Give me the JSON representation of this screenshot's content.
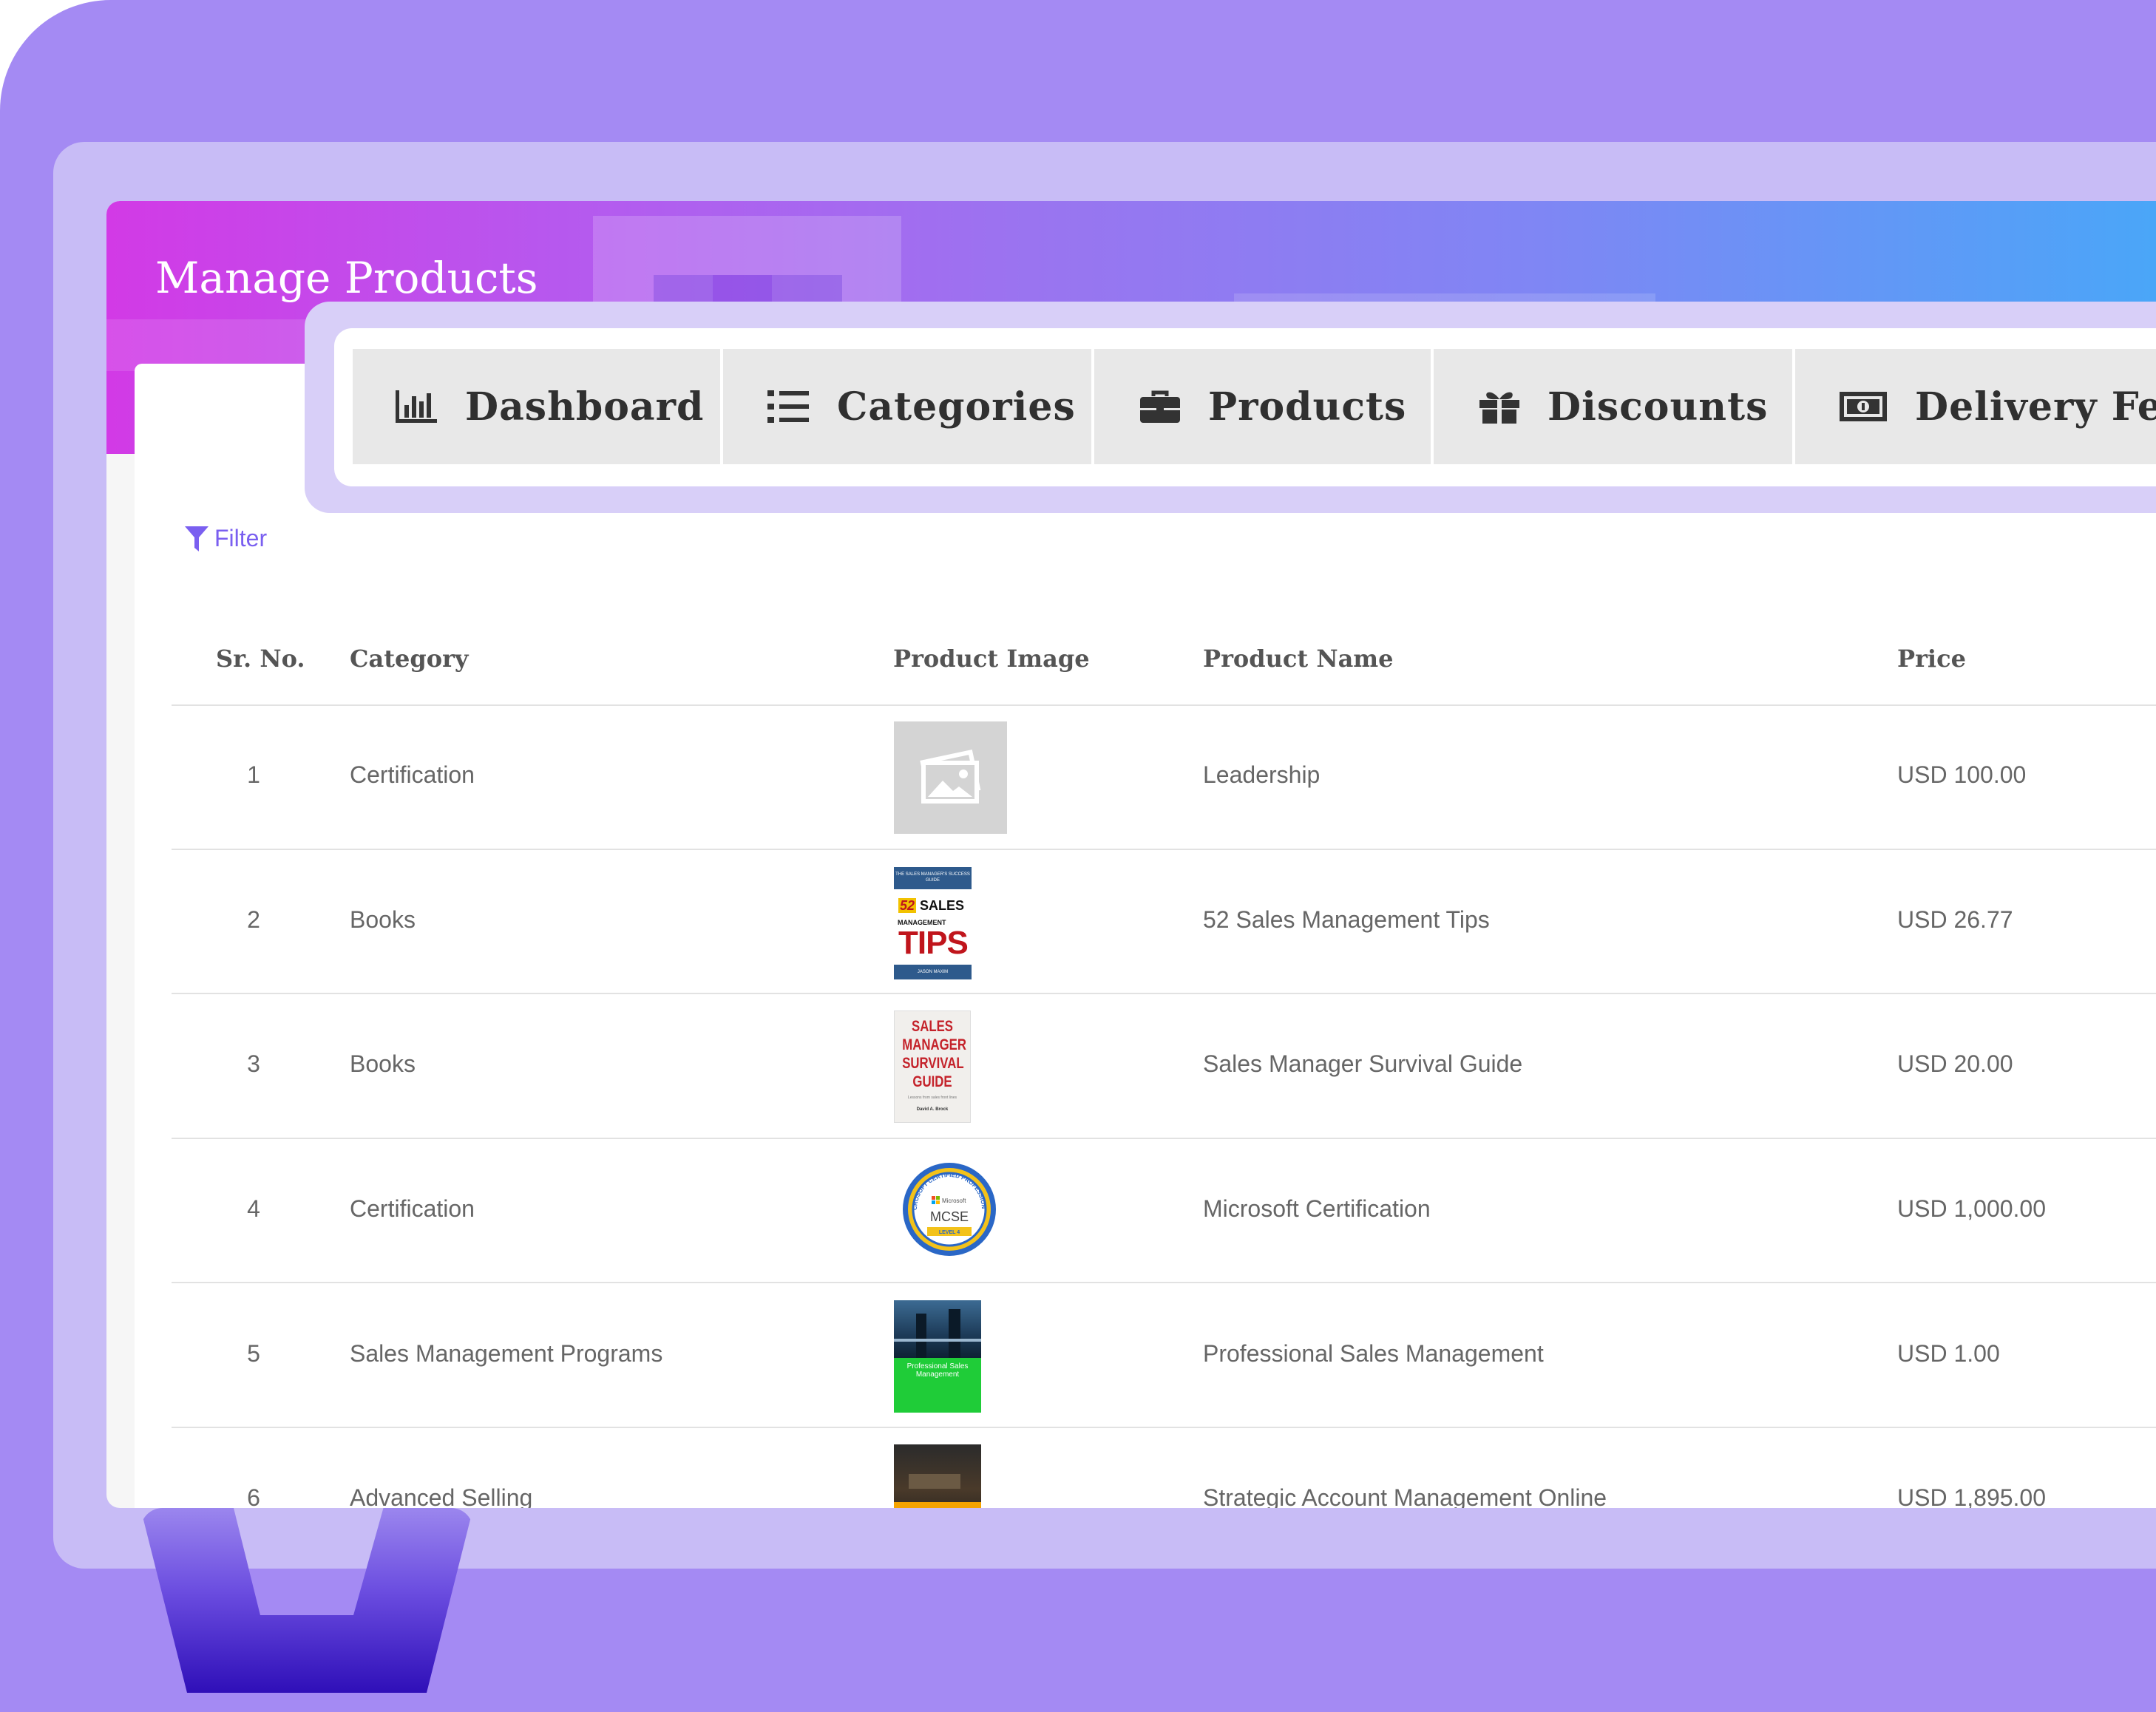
{
  "page_title": "Manage Products",
  "nav": [
    {
      "label": "Dashboard",
      "icon": "bar-chart-icon"
    },
    {
      "label": "Categories",
      "icon": "list-icon"
    },
    {
      "label": "Products",
      "icon": "briefcase-icon"
    },
    {
      "label": "Discounts",
      "icon": "gift-icon"
    },
    {
      "label": "Delivery Fee",
      "icon": "money-bill-icon"
    }
  ],
  "filter_label": "Filter",
  "table": {
    "headers": [
      "Sr. No.",
      "Category",
      "Product Image",
      "Product Name",
      "Price"
    ],
    "rows": [
      {
        "sr": "1",
        "category": "Certification",
        "image": "placeholder-image-icon",
        "name": "Leadership",
        "price": "USD 100.00"
      },
      {
        "sr": "2",
        "category": "Books",
        "image": "book-cover-52-sales-management-tips",
        "name": "52 Sales Management Tips",
        "price": "USD 26.77",
        "cover": {
          "top": "THE SALES MANAGER'S SUCCESS GUIDE",
          "num": "52",
          "word1": "SALES",
          "word2": "MANAGEMENT",
          "big": "TIPS",
          "bottom": "JASON MAXIM"
        }
      },
      {
        "sr": "3",
        "category": "Books",
        "image": "book-cover-sales-manager-survival-guide",
        "name": "Sales Manager Survival Guide",
        "price": "USD 20.00",
        "cover": {
          "l1": "SALES",
          "l2": "MANAGER",
          "l3": "SURVIVAL",
          "l4": "GUIDE",
          "small": "Lessons from sales front lines",
          "author": "David A. Brock"
        }
      },
      {
        "sr": "4",
        "category": "Certification",
        "image": "mcse-badge",
        "name": "Microsoft Certification",
        "price": "USD 1,000.00",
        "badge": {
          "ring": "MICROSOFT CERTIFIED PROFESSIONAL",
          "brand": "Microsoft",
          "text": "MCSE",
          "level": "LEVEL 4"
        }
      },
      {
        "sr": "5",
        "category": "Sales Management Programs",
        "image": "professional-sales-management-cover",
        "name": "Professional Sales Management",
        "price": "USD 1.00",
        "cover": {
          "title": "Professional Sales Management"
        }
      },
      {
        "sr": "6",
        "category": "Advanced Selling",
        "image": "strategic-account-cover",
        "name": "Strategic Account Management Online",
        "price": "USD 1,895.00"
      }
    ]
  },
  "colors": {
    "background": "#a48af3",
    "header_gradient_start": "#d23ae6",
    "header_gradient_end": "#4aa6f8",
    "accent": "#7a5ff0",
    "nav_button": "#e8e8e8"
  }
}
